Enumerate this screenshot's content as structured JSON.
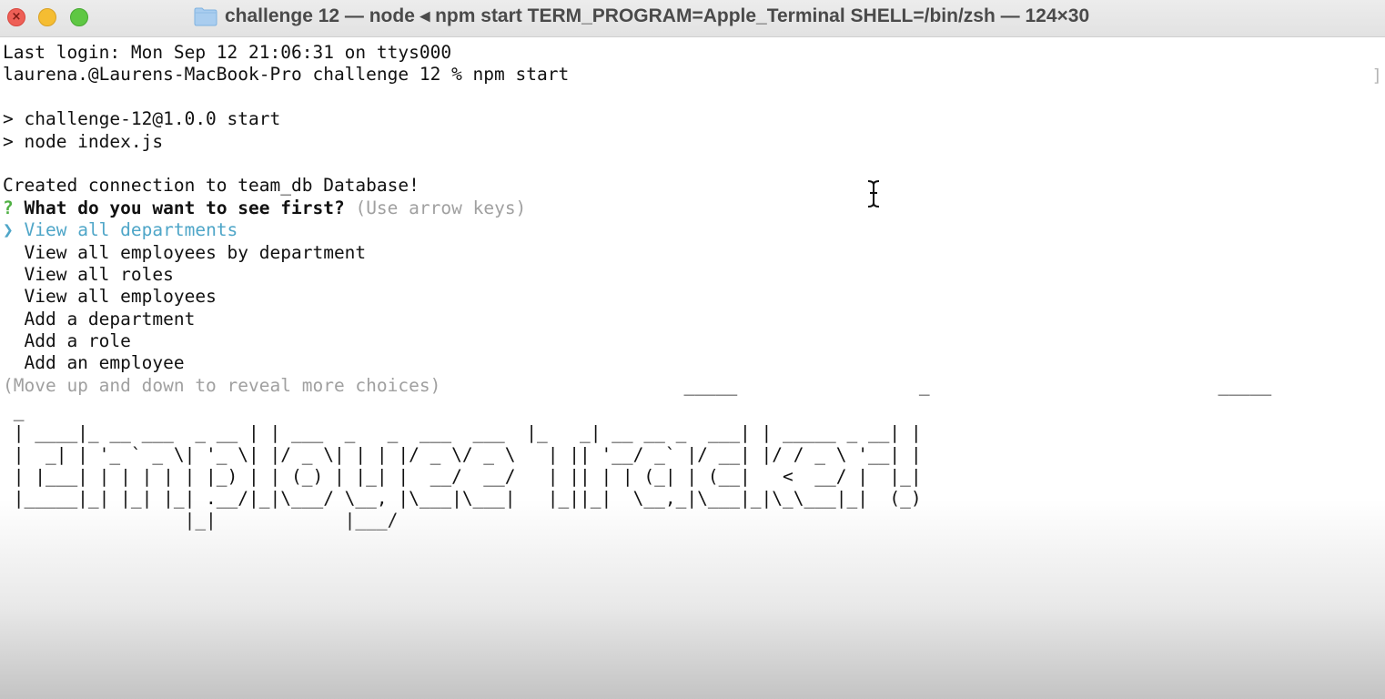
{
  "window": {
    "title": "challenge 12 — node ◂ npm start TERM_PROGRAM=Apple_Terminal SHELL=/bin/zsh — 124×30",
    "folder_icon": "folder-icon",
    "buttons": [
      "close",
      "minimize",
      "zoom"
    ]
  },
  "terminal": {
    "last_login": "Last login: Mon Sep 12 21:06:31 on ttys000",
    "prompt": "laurena.@Laurens-MacBook-Pro challenge 12 % npm start",
    "script_line1": "> challenge-12@1.0.0 start",
    "script_line2": "> node index.js",
    "connection": "Created connection to team_db Database!",
    "question_mark": "?",
    "question": "What do you want to see first?",
    "hint": "(Use arrow keys)",
    "pointer": "❯",
    "choices": [
      "View all departments",
      "View all employees by department",
      "View all roles",
      "View all employees",
      "Add a department",
      "Add a role",
      "Add an employee"
    ],
    "more_choices": "(Move up and down to reveal more choices)",
    "scroll_marker": "]",
    "ascii_art": [
      "                     _____                 _                           _____                 _",
      " _",
      " | ____|_ __ ___  _ __ | | ___  _   _  ___  ___  |_   _| __ __ _  ___| | _____ _ __| |",
      " |  _| | '_ ` _ \\| '_ \\| |/ _ \\| | | |/ _ \\/ _ \\   | || '__/ _` |/ __| |/ / _ \\ '__| |",
      " | |___| | | | | | |_) | | (_) | |_| |  __/  __/   | || | | (_| | (__|   <  __/ |  |_|",
      " |_____|_| |_| |_| .__/|_|\\___/ \\__, |\\___|\\___|   |_||_|  \\__,_|\\___|_|\\_\\___|_|  (_)",
      "                 |_|            |___/"
    ]
  },
  "colors": {
    "question_mark": "#4fb043",
    "selected_choice": "#4fa6c8",
    "dim_text": "#a0a0a0"
  }
}
